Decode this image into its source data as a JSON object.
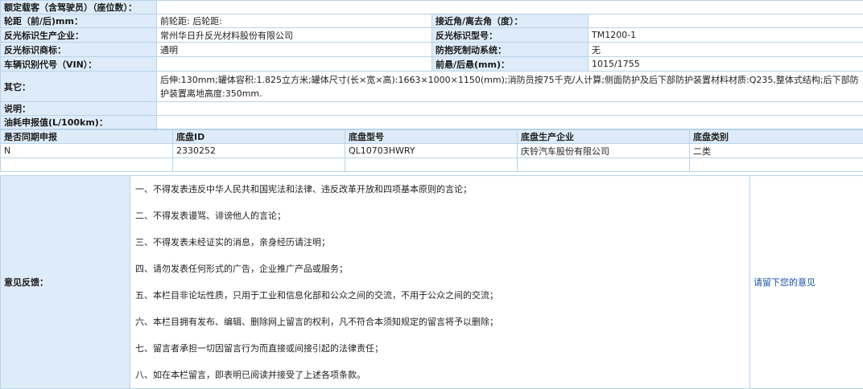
{
  "spec": {
    "rated_passengers_label": "额定载客（含驾驶员）（座位数）：",
    "rated_passengers_value": "",
    "wheelbase_label": "轮距（前/后)mm：",
    "wheelbase_value": "前轮距: 后轮距:",
    "approach_angle_label": "接近角/离去角（度）：",
    "approach_angle_value": "",
    "reflector_maker_label": "反光标识生产企业：",
    "reflector_maker_value": "常州华日升反光材料股份有限公司",
    "reflector_model_label": "反光标识型号：",
    "reflector_model_value": "TM1200-1",
    "reflector_brand_label": "反光标识商标：",
    "reflector_brand_value": "通明",
    "abs_label": "防抱死制动系统：",
    "abs_value": "无",
    "vin_label": "车辆识别代号（VIN）：",
    "vin_value": "",
    "overhang_label": "前悬/后悬(mm)：",
    "overhang_value": "1015/1755",
    "other_label": "其它：",
    "other_value": "后伸:130mm;罐体容积:1.825立方米;罐体尺寸(长×宽×高):1663×1000×1150(mm);消防员按75千克/人计算;侧面防护及后下部防护装置材料材质:Q235,整体式结构;后下部防护装置离地高度:350mm.",
    "note_label": "说明：",
    "note_value": "",
    "fuel_label": "油耗申报值(L/100km)：",
    "fuel_value": ""
  },
  "chassis": {
    "headers": [
      "是否同期申报",
      "底盘ID",
      "底盘型号",
      "底盘生产企业",
      "底盘类别"
    ],
    "row": [
      "N",
      "2330252",
      "QL10703HWRY",
      "庆铃汽车股份有限公司",
      "二类"
    ]
  },
  "feedback": {
    "label": "意见反馈：",
    "rules": [
      "一、不得发表违反中华人民共和国宪法和法律、违反改革开放和四项基本原则的言论；",
      "二、不得发表谩骂、诽谤他人的言论；",
      "三、不得发表未经证实的消息，亲身经历请注明；",
      "四、请勿发表任何形式的广告，企业推广产品或服务；",
      "五、本栏目非论坛性质，只用于工业和信息化部和公众之间的交流，不用于公众之间的交流；",
      "六、本栏目拥有发布、编辑、删除网上留言的权利，凡不符合本须知规定的留言将予以删除；",
      "七、留言者承担一切因留言行为而直接或间接引起的法律责任；",
      "八、如在本栏留言，即表明已阅读并接受了上述各项条款。"
    ],
    "link_label": "请留下您的意见"
  }
}
